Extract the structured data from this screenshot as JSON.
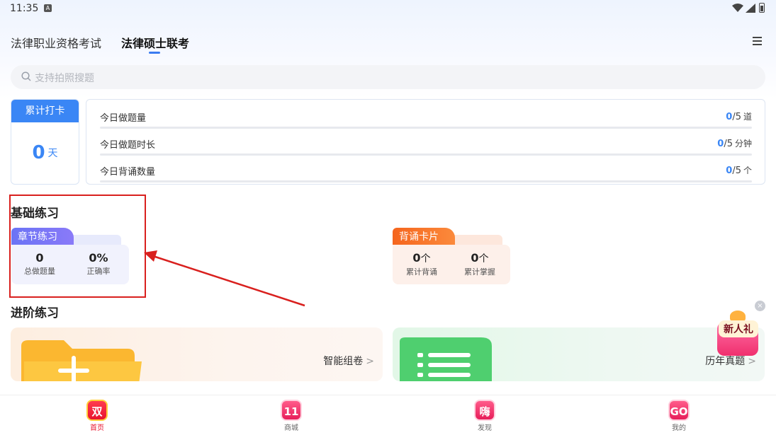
{
  "status_bar": {
    "time": "11:35",
    "notification_glyph": "A",
    "icons": [
      "wifi-icon",
      "signal-icon",
      "battery-icon"
    ]
  },
  "tabs": [
    {
      "label": "法律职业资格考试",
      "active": false
    },
    {
      "label": "法律硕士联考",
      "active": true
    }
  ],
  "search": {
    "placeholder": "支持拍照搜题"
  },
  "checkin": {
    "title": "累计打卡",
    "value": "0",
    "unit": "天"
  },
  "stats": [
    {
      "label": "今日做题量",
      "current": "0",
      "total": "/5",
      "unit": "道",
      "progress": 0
    },
    {
      "label": "今日做题时长",
      "current": "0",
      "total": "/5",
      "unit": "分钟",
      "progress": 0
    },
    {
      "label": "今日背诵数量",
      "current": "0",
      "total": "/5",
      "unit": "个",
      "progress": 0
    }
  ],
  "basic": {
    "title": "基础练习",
    "chapter": {
      "tab": "章节练习",
      "stats": [
        {
          "value": "0",
          "unit": "",
          "label": "总做题量"
        },
        {
          "value": "0%",
          "unit": "",
          "label": "正确率"
        }
      ]
    },
    "recite": {
      "tab": "背诵卡片",
      "stats": [
        {
          "value": "0",
          "unit": "个",
          "label": "累计背诵"
        },
        {
          "value": "0",
          "unit": "个",
          "label": "累计掌握"
        }
      ]
    }
  },
  "advanced": {
    "title": "进阶练习",
    "smart_paper": {
      "label": "智能组卷",
      "chevron": ">"
    },
    "past_papers": {
      "label": "历年真题",
      "chevron": ">"
    }
  },
  "gift": {
    "text": "新人礼",
    "close": "×"
  },
  "bottom_nav": [
    {
      "icon_text": "双",
      "label": "首页",
      "active": true
    },
    {
      "icon_text": "11",
      "label": "商城",
      "active": false
    },
    {
      "icon_text": "嗨",
      "label": "发现",
      "active": false
    },
    {
      "icon_text": "GO",
      "label": "我的",
      "active": false
    }
  ],
  "colors": {
    "accent": "#3a86f5",
    "annotation": "#d9201e",
    "chapter_tab": "#6a73f5",
    "recite_tab": "#f5651d"
  }
}
